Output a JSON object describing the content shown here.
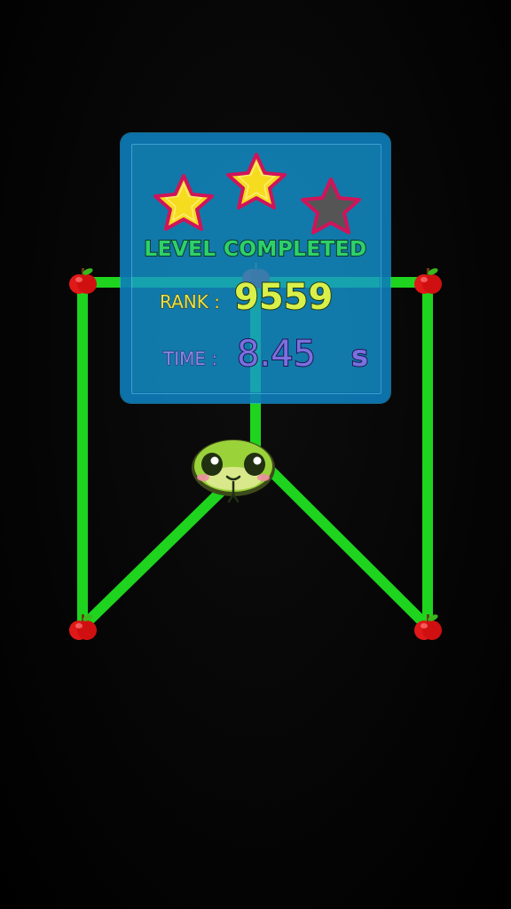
{
  "result": {
    "title": "LEVEL COMPLETED",
    "rank_label": "RANK :",
    "rank_value": "9559",
    "time_label": "TIME :",
    "time_value": "8.45",
    "time_unit": "s",
    "stars_earned": 2,
    "stars_total": 3
  },
  "game": {
    "node_icon": "apple-icon",
    "player_icon": "snake-head-icon",
    "line_color": "#1ed41e",
    "panel_color": "#1496d2",
    "background_color": "#000000"
  },
  "colors": {
    "star_filled": "#f6dc1e",
    "star_empty": "#555555",
    "star_outline": "#d0145a",
    "title_text": "#2fd06a",
    "rank_text": "#d8f04a",
    "time_text": "#7a70e0"
  }
}
